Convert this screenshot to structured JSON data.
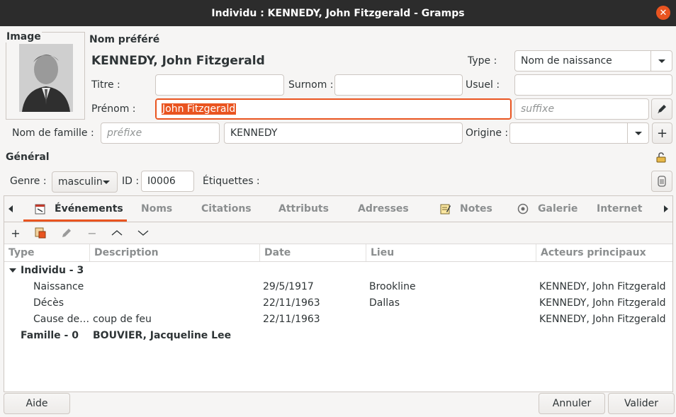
{
  "window": {
    "title": "Individu : KENNEDY, John Fitzgerald - Gramps"
  },
  "image": {
    "label": "Image"
  },
  "name": {
    "section_label": "Nom préféré",
    "display_name": "KENNEDY, John Fitzgerald",
    "type_label": "Type :",
    "type_value": "Nom de naissance",
    "title_label": "Titre :",
    "title_value": "",
    "nick_label": "Surnom :",
    "nick_value": "",
    "call_label": "Usuel :",
    "call_value": "",
    "given_label": "Prénom :",
    "given_value": "John Fitzgerald",
    "suffix_placeholder": "suffixe",
    "surname_label": "Nom de famille :",
    "prefix_placeholder": "préfixe",
    "surname_value": "KENNEDY",
    "origin_label": "Origine :",
    "origin_value": ""
  },
  "general": {
    "section_label": "Général",
    "gender_label": "Genre :",
    "gender_value": "masculin",
    "id_label": "ID :",
    "id_value": "I0006",
    "tags_label": "Étiquettes :"
  },
  "tabs": [
    {
      "label": "Événements",
      "active": true,
      "icon": "events-icon"
    },
    {
      "label": "Noms"
    },
    {
      "label": "Citations"
    },
    {
      "label": "Attributs"
    },
    {
      "label": "Adresses"
    },
    {
      "label": "Notes",
      "icon": "notes-icon"
    },
    {
      "label": "Galerie",
      "icon": "gallery-icon"
    },
    {
      "label": "Internet"
    }
  ],
  "table": {
    "columns": [
      "Type",
      "Description",
      "Date",
      "Lieu",
      "Acteurs principaux"
    ],
    "group1": {
      "label": "Individu - 3"
    },
    "rows": [
      {
        "type": "Naissance",
        "description": "",
        "date": "29/5/1917",
        "place": "Brookline",
        "actors": "KENNEDY, John Fitzgerald"
      },
      {
        "type": "Décès",
        "description": "",
        "date": "22/11/1963",
        "place": "Dallas",
        "actors": "KENNEDY, John Fitzgerald"
      },
      {
        "type": "Cause de…",
        "description": "coup de feu",
        "date": "22/11/1963",
        "place": "",
        "actors": "KENNEDY, John Fitzgerald"
      }
    ],
    "group2": {
      "label": "Famille  - 0",
      "description": "BOUVIER, Jacqueline Lee"
    }
  },
  "footer": {
    "help": "Aide",
    "cancel": "Annuler",
    "ok": "Valider"
  },
  "colors": {
    "accent": "#e95420",
    "titlebar": "#2c2c2c"
  }
}
